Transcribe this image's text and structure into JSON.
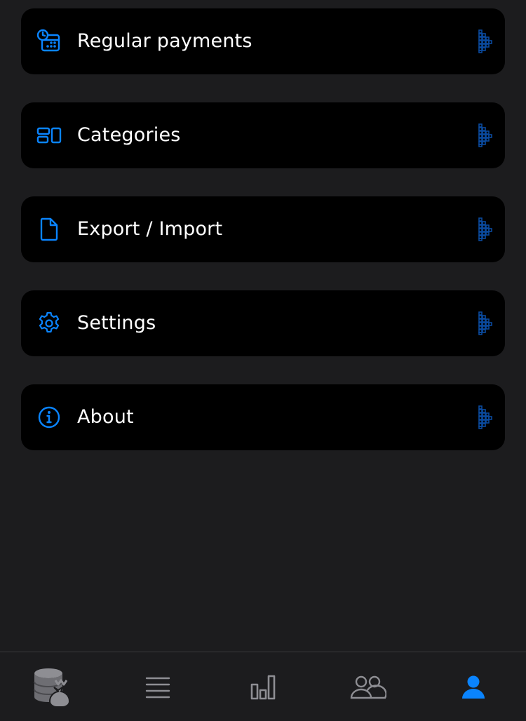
{
  "colors": {
    "background": "#1c1c1e",
    "card": "#000000",
    "accent": "#0a84ff",
    "chevron": "#0a4a9e",
    "tab_inactive": "#8e8e93",
    "text": "#ffffff"
  },
  "menu": {
    "items": [
      {
        "label": "Regular payments",
        "icon": "calendar-clock-icon"
      },
      {
        "label": "Categories",
        "icon": "categories-icon"
      },
      {
        "label": "Export / Import",
        "icon": "document-icon"
      },
      {
        "label": "Settings",
        "icon": "gear-icon"
      },
      {
        "label": "About",
        "icon": "info-icon"
      }
    ]
  },
  "tabbar": {
    "tabs": [
      {
        "name": "wallet",
        "icon": "money-bag-icon",
        "active": false
      },
      {
        "name": "transactions",
        "icon": "list-icon",
        "active": false
      },
      {
        "name": "statistics",
        "icon": "bar-chart-icon",
        "active": false
      },
      {
        "name": "people",
        "icon": "people-icon",
        "active": false
      },
      {
        "name": "profile",
        "icon": "person-icon",
        "active": true
      }
    ]
  }
}
